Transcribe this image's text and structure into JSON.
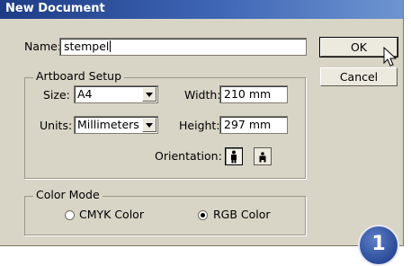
{
  "dialog": {
    "title": "New Document",
    "name_label": "Name:",
    "name_value": "stempel",
    "ok_label": "OK",
    "cancel_label": "Cancel"
  },
  "artboard": {
    "legend": "Artboard Setup",
    "size_label": "Size:",
    "size_value": "A4",
    "width_label": "Width:",
    "width_value": "210 mm",
    "units_label": "Units:",
    "units_value": "Millimeters",
    "height_label": "Height:",
    "height_value": "297 mm",
    "orientation_label": "Orientation:",
    "orientation_selected": "portrait"
  },
  "color_mode": {
    "legend": "Color Mode",
    "options": [
      "CMYK Color",
      "RGB Color"
    ],
    "selected": "RGB Color"
  },
  "badge": {
    "label": "1"
  },
  "colors": {
    "titlebar_start": "#1e3c86",
    "titlebar_end": "#6e95d0",
    "dialog_bg": "#d8d4c6",
    "badge": "#2b4a98"
  }
}
